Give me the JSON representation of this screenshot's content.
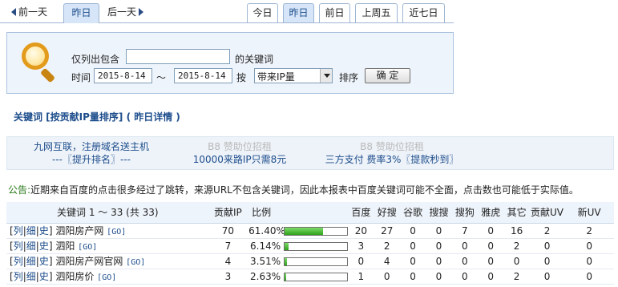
{
  "nav": {
    "prev_day": "前一天",
    "yesterday": "昨日",
    "next_day": "后一天"
  },
  "date_tabs": [
    "今日",
    "昨日",
    "前日",
    "上周五",
    "近七日"
  ],
  "date_tab_active": 1,
  "filter": {
    "contain_label": "仅列出包含",
    "contain_value": "",
    "contain_suffix": "的关键词",
    "time_label": "时间",
    "start_date": "2015-8-14",
    "range_sep": "～",
    "end_date": "2015-8-14",
    "by_label": "按",
    "by_value": "带来IP量",
    "sort_label": "排序",
    "confirm_label": "确 定"
  },
  "section_title": "关键词 [按贡献IP量排序] ( 昨日详情 )",
  "ads": [
    {
      "line1": "九网互联，注册域名送主机",
      "line2": "---〖提升排名〗---",
      "line1_muted": false
    },
    {
      "line1": "B8 赞助位招租",
      "line2": "10000来路IP只需8元",
      "line1_muted": true
    },
    {
      "line1": "B8 赞助位招租",
      "line2": "三方支付 费率3%〖提款秒到〗",
      "line1_muted": true
    }
  ],
  "notice": {
    "tag": "公告:",
    "text": "近期来自百度的点击很多经过了跳转，来源URL不包含关键词，因此本报表中百度关键词可能不全面，点击数也可能低于实际值。"
  },
  "table": {
    "headers": {
      "keyword": "关键词 1 ～ 33 (共 33)",
      "ip": "贡献IP",
      "ratio": "比例",
      "baidu": "百度",
      "haosou": "好搜",
      "google": "谷歌",
      "sousou": "搜搜",
      "sogou": "搜狗",
      "yahoo": "雅虎",
      "other": "其它",
      "uv": "贡献UV",
      "new_uv": "新UV"
    },
    "link_labels": [
      "列",
      "细",
      "史"
    ],
    "go_label": "[GO]",
    "rows": [
      {
        "keyword": "泗阳房产网",
        "ip": "70",
        "ratio": "61.40%",
        "ratio_value": 0.614,
        "baidu": "20",
        "haosou": "27",
        "google": "0",
        "sousou": "0",
        "sogou": "7",
        "yahoo": "0",
        "other": "16",
        "uv": "2",
        "new_uv": "2"
      },
      {
        "keyword": "泗阳",
        "ip": "7",
        "ratio": "6.14%",
        "ratio_value": 0.0614,
        "baidu": "3",
        "haosou": "2",
        "google": "0",
        "sousou": "0",
        "sogou": "0",
        "yahoo": "0",
        "other": "2",
        "uv": "0",
        "new_uv": "0"
      },
      {
        "keyword": "泗阳房产网官网",
        "ip": "4",
        "ratio": "3.51%",
        "ratio_value": 0.0351,
        "baidu": "0",
        "haosou": "4",
        "google": "0",
        "sousou": "0",
        "sogou": "0",
        "yahoo": "0",
        "other": "0",
        "uv": "0",
        "new_uv": "0"
      },
      {
        "keyword": "泗阳房价",
        "ip": "3",
        "ratio": "2.63%",
        "ratio_value": 0.0263,
        "baidu": "1",
        "haosou": "0",
        "google": "0",
        "sousou": "0",
        "sogou": "0",
        "yahoo": "0",
        "other": "2",
        "uv": "0",
        "new_uv": "0"
      }
    ]
  },
  "colors": {
    "accent_blue": "#1d4d8c",
    "panel_bg": "#eef4fb",
    "bar_green": "#2ea21b",
    "notice_green": "#2a7a1a"
  }
}
